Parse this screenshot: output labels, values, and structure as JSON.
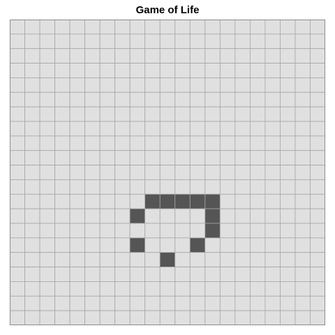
{
  "title": "Game of Life",
  "grid": {
    "cols": 21,
    "rows": 21,
    "live_cells": [
      [
        12,
        9
      ],
      [
        12,
        10
      ],
      [
        12,
        11
      ],
      [
        12,
        12
      ],
      [
        12,
        13
      ],
      [
        13,
        8
      ],
      [
        13,
        13
      ],
      [
        14,
        13
      ],
      [
        15,
        8
      ],
      [
        15,
        12
      ],
      [
        16,
        10
      ]
    ]
  },
  "colors": {
    "dead_cell": "#e0e0e0",
    "live_cell": "#555555",
    "grid_line": "#a6a6a6",
    "border": "#8c8c8c"
  }
}
